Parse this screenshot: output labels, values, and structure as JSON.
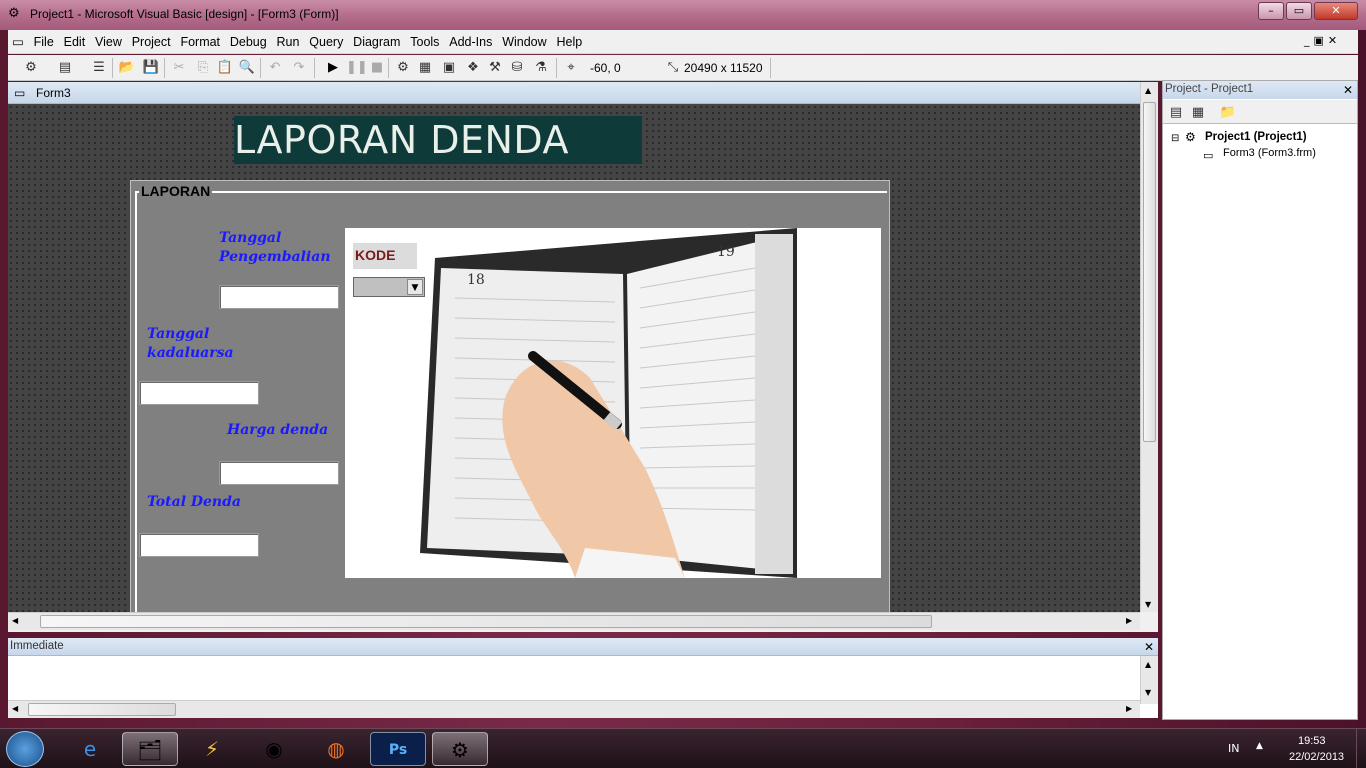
{
  "window": {
    "title": "Project1 - Microsoft Visual Basic [design] - [Form3 (Form)]"
  },
  "menu": [
    "File",
    "Edit",
    "View",
    "Project",
    "Format",
    "Debug",
    "Run",
    "Query",
    "Diagram",
    "Tools",
    "Add-Ins",
    "Window",
    "Help"
  ],
  "toolbar": {
    "position": "-60, 0",
    "size": "20490 x 11520"
  },
  "designer": {
    "title": "Form3"
  },
  "form": {
    "banner": "LAPORAN DENDA",
    "frame_caption": "LAPORAN",
    "labels": {
      "tanggal_pengembalian": "Tanggal\nPengembalian",
      "tanggal_kadaluarsa": "Tanggal\nkadaluarsa",
      "harga_denda": "Harga denda",
      "total_denda": "Total Denda",
      "kode": "KODE"
    }
  },
  "immediate": {
    "title": "Immediate"
  },
  "project": {
    "title": "Project - Project1",
    "root": "Project1 (Project1)",
    "child": "Form3 (Form3.frm)"
  },
  "taskbar": {
    "lang": "IN",
    "time": "19:53",
    "date": "22/02/2013"
  },
  "colors": {
    "titlebar": "#b56e8e",
    "banner_bg": "#0f3a3a",
    "label_text": "#1a1aff",
    "frame_bg": "#808080"
  }
}
